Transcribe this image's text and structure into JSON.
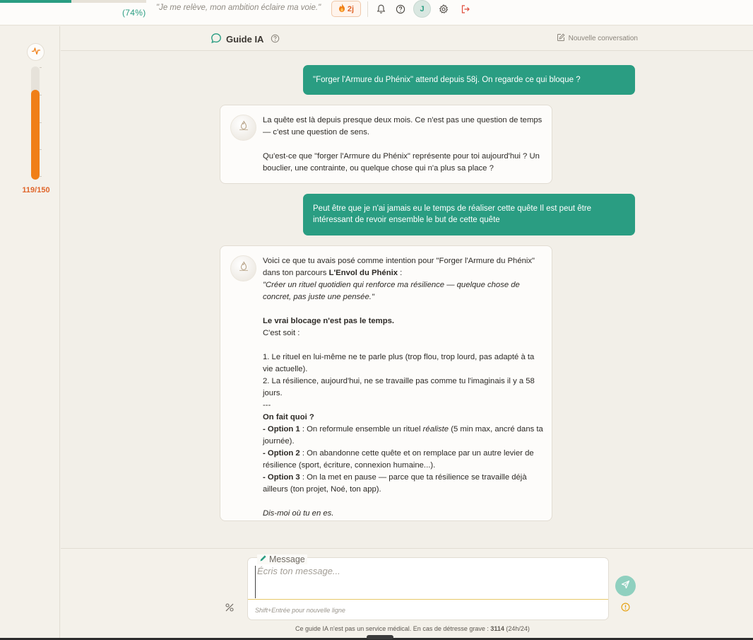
{
  "topbar": {
    "progress_percent": 49,
    "progress_label": "(74%)",
    "motto": "\"Je me relève, mon ambition éclaire ma voie.\"",
    "streak": "2j",
    "avatar_initial": "J"
  },
  "rail": {
    "gauge_value": 119,
    "gauge_max": 150,
    "gauge_label": "119/150"
  },
  "header": {
    "title": "Guide IA",
    "new_conversation": "Nouvelle conversation"
  },
  "messages": [
    {
      "role": "user",
      "text": "\"Forger l'Armure du Phénix\" attend depuis 58j. On regarde ce qui bloque ?"
    },
    {
      "role": "ai",
      "p1": "La quête est là depuis presque deux mois. Ce n'est pas une question de temps — c'est une question de sens.",
      "p2": "Qu'est-ce que \"forger l'Armure du Phénix\" représente pour toi aujourd'hui ? Un bouclier, une contrainte, ou quelque chose qui n'a plus sa place ?"
    },
    {
      "role": "user",
      "text": "Peut être que je n'ai jamais eu le temps de réaliser cette quête Il est peut être intéressant de revoir ensemble le but de cette quête"
    },
    {
      "role": "ai",
      "intro_a": "Voici ce que tu avais posé comme intention pour \"Forger l'Armure du Phénix\" dans ton parcours ",
      "intro_b": "L'Envol du Phénix",
      "intro_c": " :",
      "quote": "\"Créer un rituel quotidien qui renforce ma résilience — quelque chose de concret, pas juste une pensée.\"",
      "block_title": "Le vrai blocage n'est pas le temps.",
      "block_sub": "C'est soit :",
      "point1": "1. Le rituel en lui-même ne te parle plus (trop flou, trop lourd, pas adapté à ta vie actuelle).",
      "point2": "2. La résilience, aujourd'hui, ne se travaille pas comme tu l'imaginais il y a 58 jours.",
      "separator": "---",
      "question": "On fait quoi ?",
      "opt1_label": "- Option 1",
      "opt1_a": " : On reformule ensemble un rituel ",
      "opt1_em": "réaliste",
      "opt1_b": " (5 min max, ancré dans ta journée).",
      "opt2_label": "- Option 2",
      "opt2_text": " : On abandonne cette quête et on remplace par un autre levier de résilience (sport, écriture, connexion humaine...).",
      "opt3_label": "- Option 3",
      "opt3_text": " : On la met en pause — parce que ta résilience se travaille déjà ailleurs (ton projet, Noé, ton app).",
      "closing": "Dis-moi où tu en es."
    }
  ],
  "composer": {
    "label": "Message",
    "placeholder": "Écris ton message...",
    "hint": "Shift+Entrée pour nouvelle ligne"
  },
  "footer": {
    "disclaimer_a": "Ce guide IA n'est pas un service médical. En cas de détresse grave : ",
    "disclaimer_number": "3114",
    "disclaimer_b": " (24h/24)"
  },
  "colors": {
    "accent": "#2a9d82",
    "orange": "#f07f17",
    "background": "#f2efe8"
  }
}
